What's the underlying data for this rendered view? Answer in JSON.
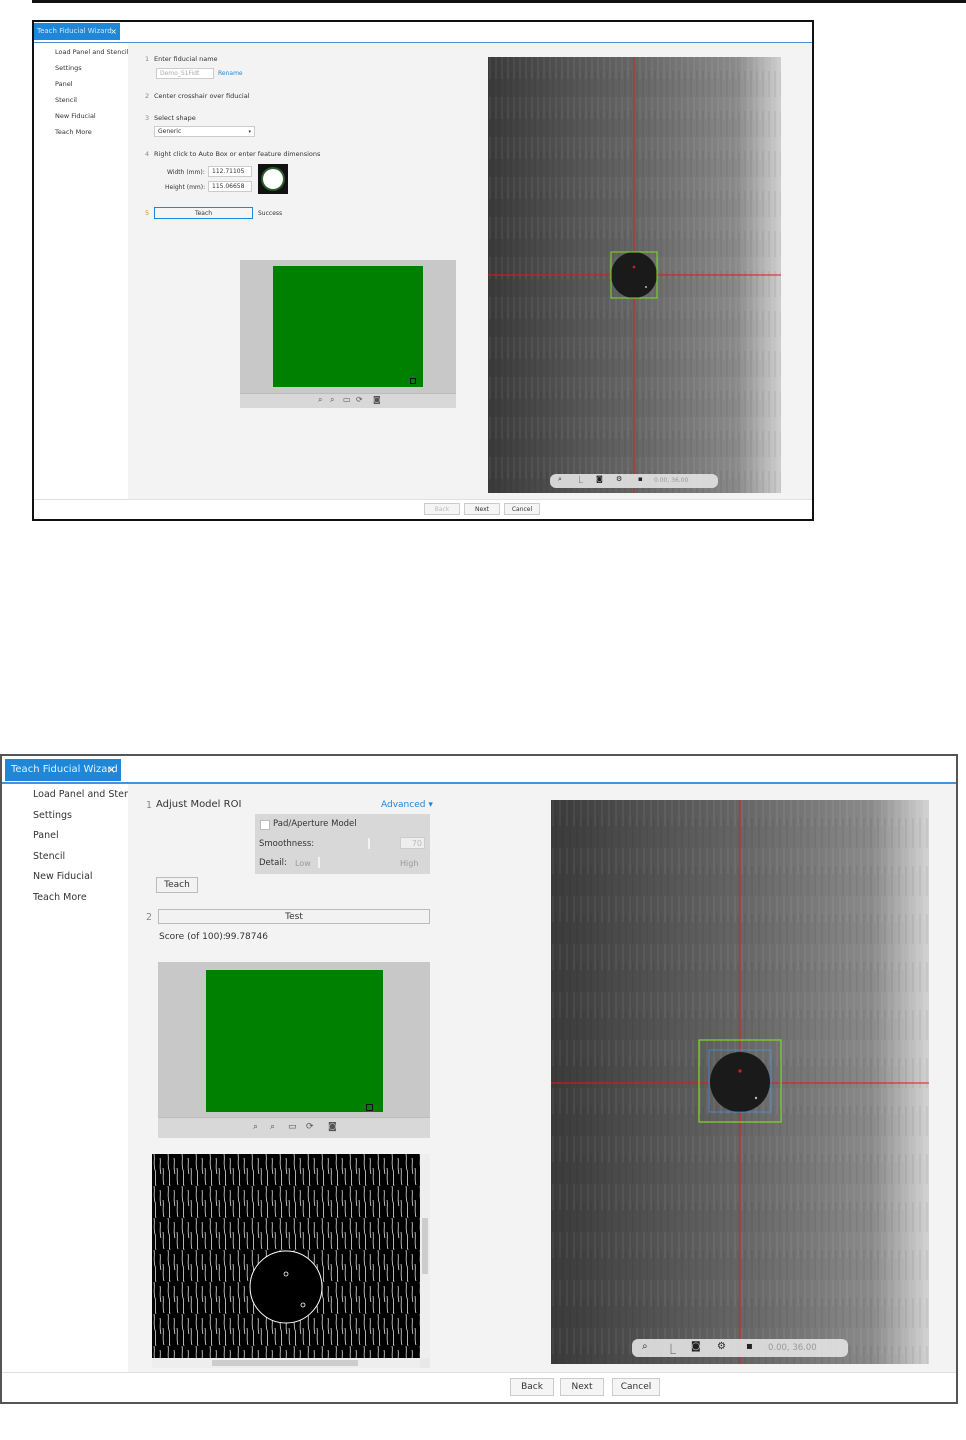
{
  "wizard_top": {
    "tab_title": "Teach Fiducial Wizard",
    "close_glyph": "×",
    "sidebar": [
      "Load Panel and Stencil",
      "Settings",
      "Panel",
      "Stencil",
      "New Fiducial",
      "Teach More"
    ],
    "step1": {
      "number": "1",
      "label": "Enter fiducial name",
      "value": "Demo_S1Fidt",
      "rename": "Rename"
    },
    "step2": {
      "number": "2",
      "label": "Center crosshair over fiducial"
    },
    "step3": {
      "number": "3",
      "label": "Select shape",
      "selected": "Generic"
    },
    "step4": {
      "number": "4",
      "label": "Right click to Auto Box or enter feature dimensions",
      "width_label": "Width (mm):",
      "width_value": "112.71105",
      "height_label": "Height (mm):",
      "height_value": "115.06658"
    },
    "step5": {
      "number": "5",
      "teach": "Teach",
      "status": "Success"
    },
    "camera_coords": "0.00, 36.00",
    "buttons": {
      "back": "Back",
      "next": "Next",
      "cancel": "Cancel"
    }
  },
  "wizard_bottom": {
    "tab_title": "Teach Fiducial Wizard",
    "close_glyph": "×",
    "sidebar": [
      "Load Panel and Stencil",
      "Settings",
      "Panel",
      "Stencil",
      "New Fiducial",
      "Teach More"
    ],
    "step1": {
      "number": "1",
      "label": "Adjust Model ROI",
      "advanced": "Advanced ▾",
      "teach": "Teach"
    },
    "advanced_panel": {
      "pad_model": "Pad/Aperture Model",
      "smoothness_label": "Smoothness:",
      "smoothness_value": "70",
      "detail_label": "Detail:",
      "detail_low": "Low",
      "detail_high": "High"
    },
    "step2": {
      "number": "2",
      "test": "Test",
      "score_label": "Score (of 100):",
      "score_value": "99.78746"
    },
    "camera_coords": "0.00, 36.00",
    "buttons": {
      "back": "Back",
      "next": "Next",
      "cancel": "Cancel"
    }
  },
  "icons": [
    "zoom-in-icon",
    "zoom-out-icon",
    "fit-icon",
    "rotate-icon",
    "camera-icon",
    "crop-icon",
    "settings-icon",
    "save-icon"
  ],
  "colors": {
    "tab_blue": "#1f87d8",
    "preview_green": "#008000",
    "crosshair": "#e0191b",
    "roi_box": "#7ddc1f"
  }
}
